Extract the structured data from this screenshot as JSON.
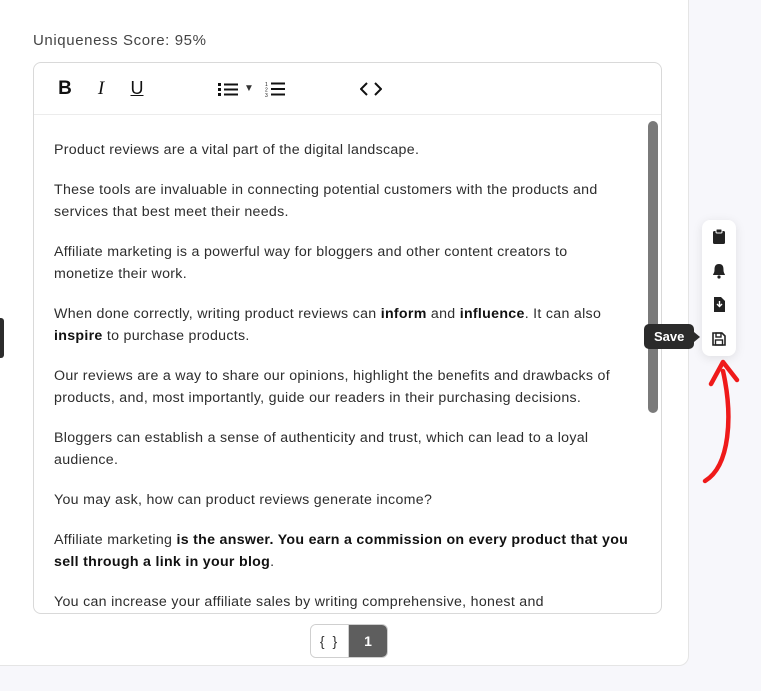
{
  "score_label": "Uniqueness Score: 95%",
  "toolbar": {
    "bold": "B",
    "italic": "I",
    "underline": "U"
  },
  "content": {
    "p1": "Product reviews are a vital part of the digital landscape.",
    "p2": "These tools are invaluable in connecting potential customers with the products and services that best meet their needs.",
    "p3": "Affiliate marketing is a powerful way for bloggers and other content creators to monetize their work.",
    "p4_a": "When done correctly, writing product reviews can ",
    "p4_b1": "inform",
    "p4_c": " and ",
    "p4_b2": "influence",
    "p4_d": ". It can also ",
    "p4_b3": "inspire",
    "p4_e": " to purchase products.",
    "p5": "Our reviews are a way to share our opinions, highlight the benefits and drawbacks of products, and, most importantly, guide our readers in their purchasing decisions.",
    "p6": "Bloggers can establish a sense of authenticity and trust, which can lead to a loyal audience.",
    "p7": "You may ask, how can product reviews generate income?",
    "p8_a": "Affiliate marketing ",
    "p8_b": "is the answer. You earn a commission on every product that you sell through a link in your blog",
    "p8_c": ".",
    "p9": "You can increase your affiliate sales by writing comprehensive, honest and"
  },
  "pager": {
    "brackets": "{ }",
    "page": "1"
  },
  "tooltip": "Save"
}
